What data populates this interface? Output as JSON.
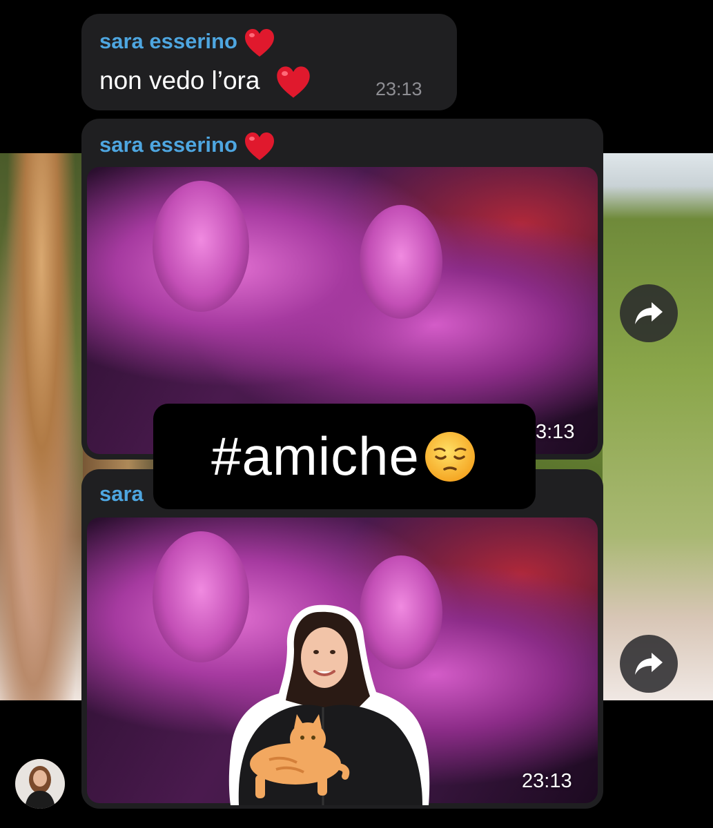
{
  "messages": [
    {
      "sender": "sara esserino",
      "text": "non vedo l’ora",
      "time": "23:13"
    },
    {
      "sender": "sara esserino",
      "time": "3:13"
    },
    {
      "sender": "sara",
      "time": "23:13"
    }
  ],
  "hashtag_sticker": "#amiche",
  "icons": {
    "forward": "forward-arrow-icon",
    "heart": "red-heart-emoji",
    "pensive": "pensive-face-emoji"
  },
  "colors": {
    "sender_name": "#4ea6e0",
    "bubble": "#1f1f21",
    "heart": "#e0192d"
  }
}
